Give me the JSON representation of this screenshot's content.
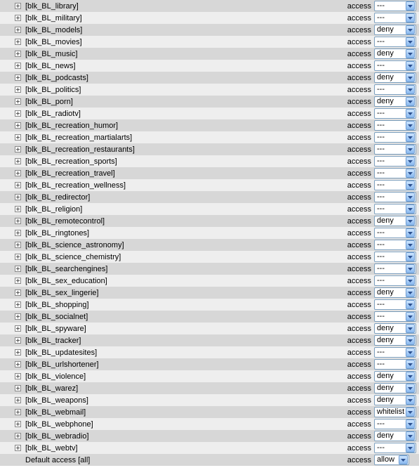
{
  "access_label": "access",
  "rows": [
    {
      "name": "[blk_BL_library]",
      "value": "---"
    },
    {
      "name": "[blk_BL_military]",
      "value": "---"
    },
    {
      "name": "[blk_BL_models]",
      "value": "deny"
    },
    {
      "name": "[blk_BL_movies]",
      "value": "---"
    },
    {
      "name": "[blk_BL_music]",
      "value": "deny"
    },
    {
      "name": "[blk_BL_news]",
      "value": "---"
    },
    {
      "name": "[blk_BL_podcasts]",
      "value": "deny"
    },
    {
      "name": "[blk_BL_politics]",
      "value": "---"
    },
    {
      "name": "[blk_BL_porn]",
      "value": "deny"
    },
    {
      "name": "[blk_BL_radiotv]",
      "value": "---"
    },
    {
      "name": "[blk_BL_recreation_humor]",
      "value": "---"
    },
    {
      "name": "[blk_BL_recreation_martialarts]",
      "value": "---"
    },
    {
      "name": "[blk_BL_recreation_restaurants]",
      "value": "---"
    },
    {
      "name": "[blk_BL_recreation_sports]",
      "value": "---"
    },
    {
      "name": "[blk_BL_recreation_travel]",
      "value": "---"
    },
    {
      "name": "[blk_BL_recreation_wellness]",
      "value": "---"
    },
    {
      "name": "[blk_BL_redirector]",
      "value": "---"
    },
    {
      "name": "[blk_BL_religion]",
      "value": "---"
    },
    {
      "name": "[blk_BL_remotecontrol]",
      "value": "deny"
    },
    {
      "name": "[blk_BL_ringtones]",
      "value": "---"
    },
    {
      "name": "[blk_BL_science_astronomy]",
      "value": "---"
    },
    {
      "name": "[blk_BL_science_chemistry]",
      "value": "---"
    },
    {
      "name": "[blk_BL_searchengines]",
      "value": "---"
    },
    {
      "name": "[blk_BL_sex_education]",
      "value": "---"
    },
    {
      "name": "[blk_BL_sex_lingerie]",
      "value": "deny"
    },
    {
      "name": "[blk_BL_shopping]",
      "value": "---"
    },
    {
      "name": "[blk_BL_socialnet]",
      "value": "---"
    },
    {
      "name": "[blk_BL_spyware]",
      "value": "deny"
    },
    {
      "name": "[blk_BL_tracker]",
      "value": "deny"
    },
    {
      "name": "[blk_BL_updatesites]",
      "value": "---"
    },
    {
      "name": "[blk_BL_urlshortener]",
      "value": "---"
    },
    {
      "name": "[blk_BL_violence]",
      "value": "deny"
    },
    {
      "name": "[blk_BL_warez]",
      "value": "deny"
    },
    {
      "name": "[blk_BL_weapons]",
      "value": "deny"
    },
    {
      "name": "[blk_BL_webmail]",
      "value": "whitelist"
    },
    {
      "name": "[blk_BL_webphone]",
      "value": "---"
    },
    {
      "name": "[blk_BL_webradio]",
      "value": "deny"
    },
    {
      "name": "[blk_BL_webtv]",
      "value": "---"
    },
    {
      "name": "Default access [all]",
      "value": "allow",
      "default": true
    }
  ]
}
